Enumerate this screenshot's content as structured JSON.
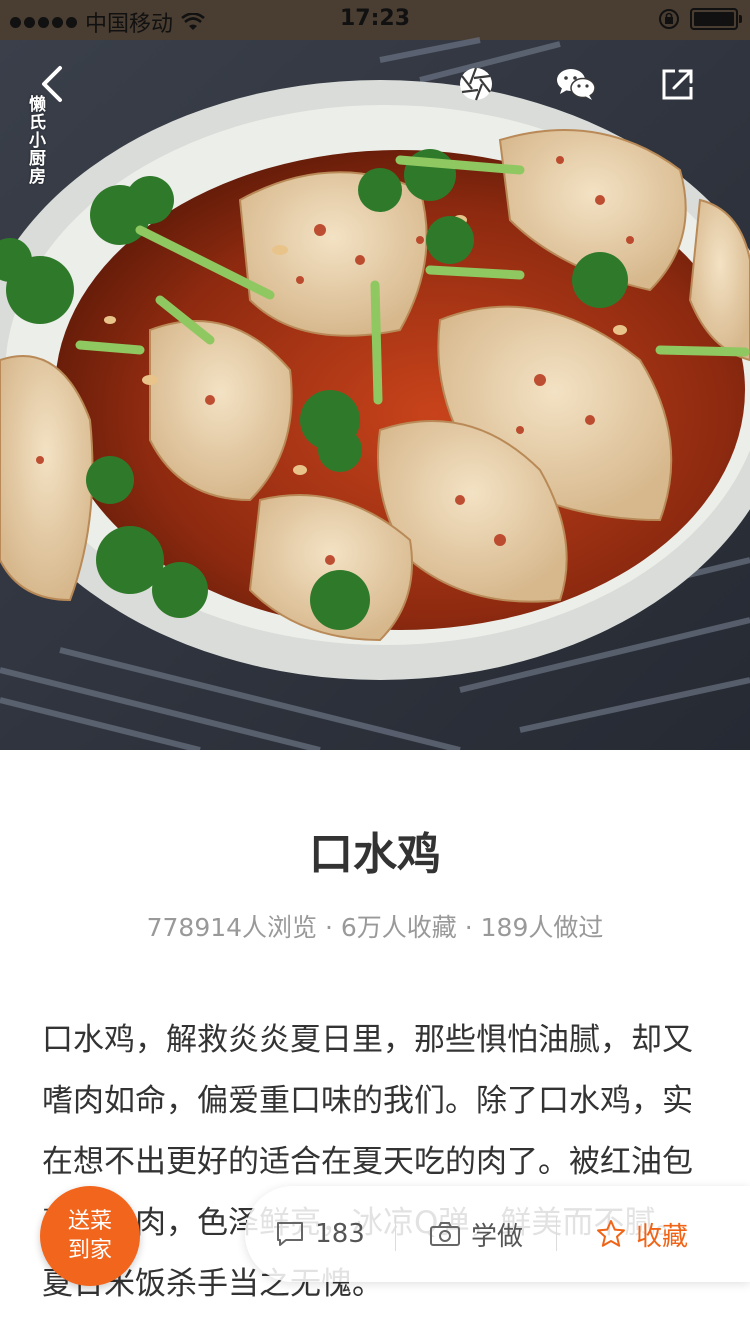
{
  "status_bar": {
    "carrier": "中国移动",
    "time": "17:23"
  },
  "hero": {
    "image_subject": "口水鸡 dish photo",
    "watermark": "懒氏小厨房"
  },
  "top_actions": {
    "back_icon": "chevron-left-icon",
    "moments_icon": "aperture-icon",
    "wechat_icon": "wechat-icon",
    "share_icon": "share-icon"
  },
  "recipe": {
    "title": "口水鸡",
    "stats": "778914人浏览 · 6万人收藏 · 189人做过",
    "description": "口水鸡，解救炎炎夏日里，那些惧怕油腻，却又嗜肉如命，偏爱重口味的我们。除了口水鸡，实在想不出更好的适合在夏天吃的肉了。被红油包裹的鸡肉，色泽鲜亮，冰凉Q弹，鲜美而不腻。夏日米饭杀手当之无愧。"
  },
  "action_bar": {
    "comment_count": "183",
    "cook_label": "学做",
    "favorite_label": "收藏"
  },
  "delivery_badge": {
    "line1": "送菜",
    "line2": "到家"
  },
  "colors": {
    "accent": "#f06418",
    "badge": "#f2651c",
    "muted_text": "#999999"
  }
}
